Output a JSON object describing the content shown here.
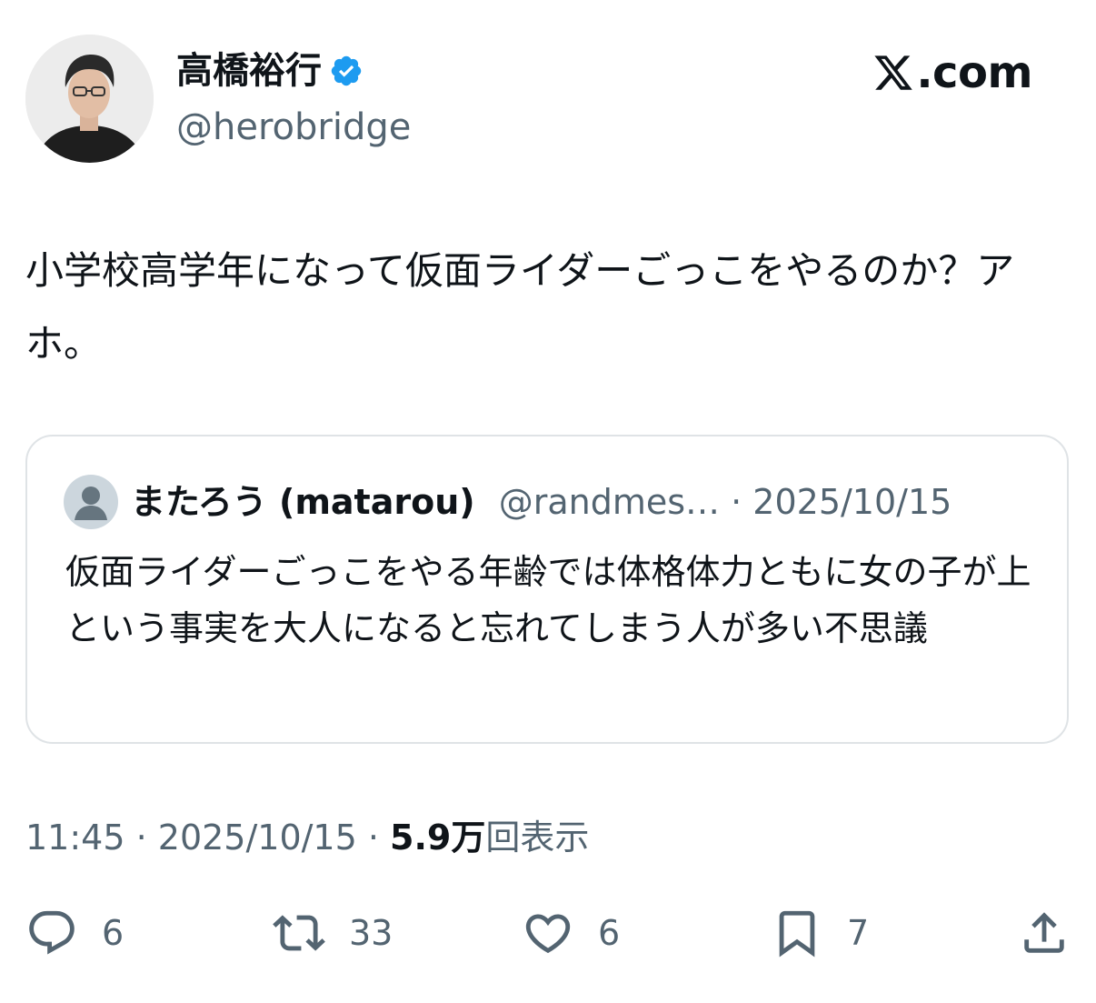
{
  "author": {
    "name": "高橋裕行",
    "handle": "@herobridge",
    "avatar_icon": "profile-photo",
    "verified_icon": "verified-badge-icon",
    "verified_color": "#1d9bf0"
  },
  "brand": {
    "logo_icon": "x-logo-icon",
    "text": ".com"
  },
  "tweet": {
    "text": "小学校高学年になって仮面ライダーごっこをやるのか？アホ。"
  },
  "quote": {
    "avatar_icon": "default-avatar-icon",
    "name": "またろう (matarou)",
    "handle": "@randmes…",
    "separator": " · ",
    "date": "2025/10/15",
    "text": "仮面ライダーごっこをやる年齢では体格体力ともに女の子が上という事実を大人になると忘れてしまう人が多い不思議"
  },
  "meta": {
    "time": "11:45",
    "sep1": " · ",
    "date": "2025/10/15",
    "sep2": " · ",
    "views_count": "5.9万",
    "views_label": "回表示"
  },
  "actions": {
    "reply": {
      "icon": "reply-icon",
      "count": "6"
    },
    "retweet": {
      "icon": "retweet-icon",
      "count": "33"
    },
    "like": {
      "icon": "heart-icon",
      "count": "6"
    },
    "bookmark": {
      "icon": "bookmark-icon",
      "count": "7"
    },
    "share": {
      "icon": "share-icon"
    }
  },
  "colors": {
    "text": "#0f1419",
    "secondary": "#536471",
    "border": "#dfe3e6"
  }
}
